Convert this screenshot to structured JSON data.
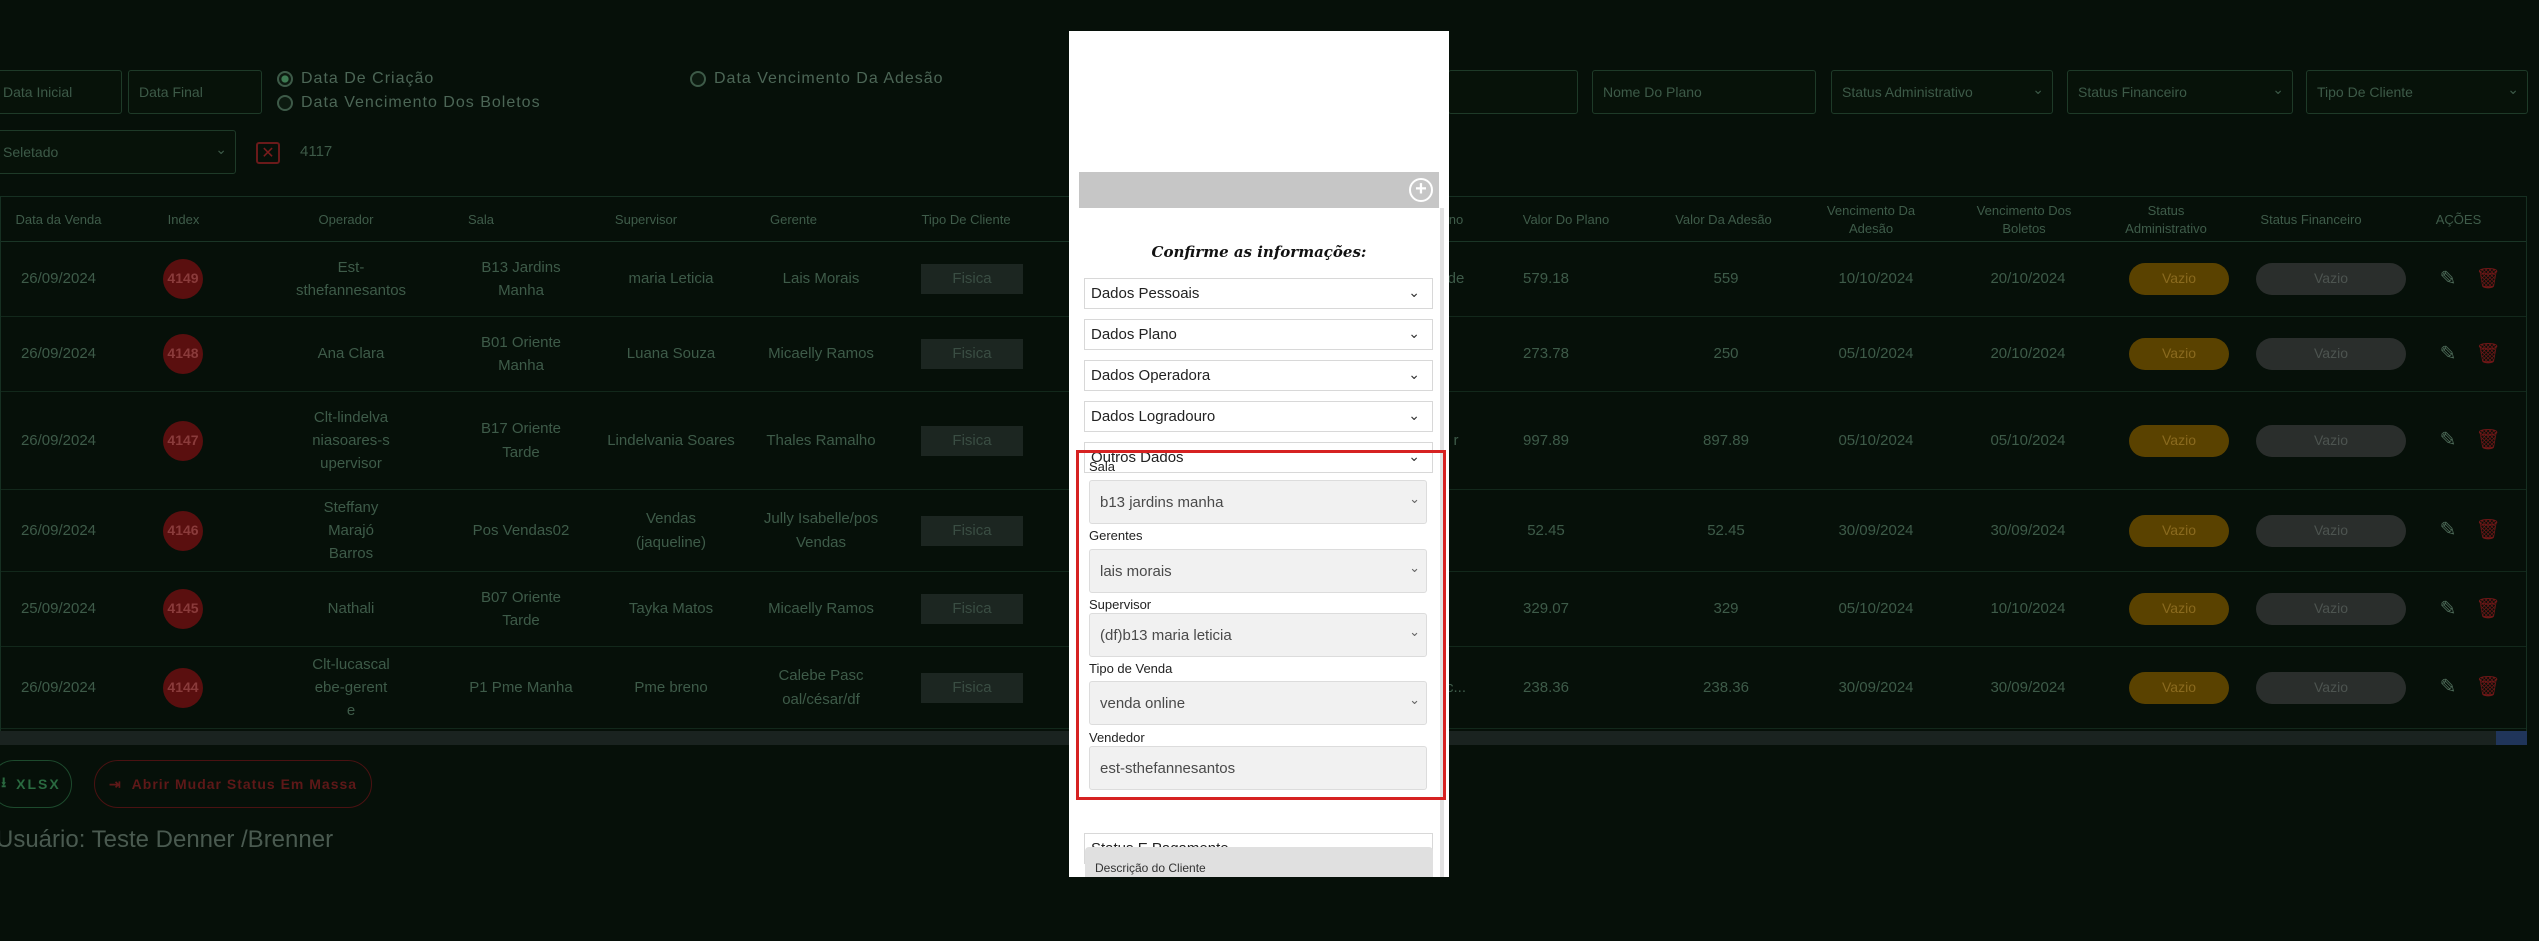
{
  "filters": {
    "data_inicial": "Data Inicial",
    "data_final": "Data Final",
    "radio_data_criacao": "Data De Criação",
    "radio_data_vencimento_boletos": "Data Vencimento Dos Boletos",
    "radio_data_vencimento_adesao": "Data Vencimento Da Adesão",
    "nome_do_plano": "Nome Do Plano",
    "status_administrativo": "Status Administrativo",
    "status_financeiro": "Status Financeiro",
    "tipo_de_cliente": "Tipo De Cliente",
    "selecionado": "Seletado",
    "clear_icon": "✕",
    "selected_count": "4117"
  },
  "table": {
    "headers": {
      "data_venda": "Data da Venda",
      "index": "Index",
      "operador": "Operador",
      "sala": "Sala",
      "supervisor": "Supervisor",
      "gerente": "Gerente",
      "tipo_cliente": "Tipo De Cliente",
      "plano": "no",
      "valor_plano": "Valor Do Plano",
      "valor_adesao": "Valor Da Adesão",
      "venc_adesao": "Vencimento Da Adesão",
      "venc_boletos": "Vencimento Dos Boletos",
      "status_adm": "Status Administrativo",
      "status_fin": "Status Financeiro",
      "acoes": "AÇÕES"
    },
    "rows": [
      {
        "data": "26/09/2024",
        "index": "4149",
        "operador": "Est-sthefannesantos",
        "sala": "B13 Jardins Manha",
        "supervisor": "maria Leticia",
        "gerente": "Lais Morais",
        "tipo": "Fisica",
        "plano": "de",
        "valor_plano": "579.18",
        "valor_adesao": "559",
        "venc_adesao": "10/10/2024",
        "venc_boletos": "20/10/2024",
        "status_adm": "Vazio",
        "status_fin": "Vazio"
      },
      {
        "data": "26/09/2024",
        "index": "4148",
        "operador": "Ana Clara",
        "sala": "B01 Oriente Manha",
        "supervisor": "Luana Souza",
        "gerente": "Micaelly Ramos",
        "tipo": "Fisica",
        "plano": "",
        "valor_plano": "273.78",
        "valor_adesao": "250",
        "venc_adesao": "05/10/2024",
        "venc_boletos": "20/10/2024",
        "status_adm": "Vazio",
        "status_fin": "Vazio"
      },
      {
        "data": "26/09/2024",
        "index": "4147",
        "operador": "Clt-lindelvaniasoares-supervisor",
        "sala": "B17 Oriente Tarde",
        "supervisor": "Lindelvania Soares",
        "gerente": "Thales Ramalho",
        "tipo": "Fisica",
        "plano": "r",
        "valor_plano": "997.89",
        "valor_adesao": "897.89",
        "venc_adesao": "05/10/2024",
        "venc_boletos": "05/10/2024",
        "status_adm": "Vazio",
        "status_fin": "Vazio"
      },
      {
        "data": "26/09/2024",
        "index": "4146",
        "operador": "Steffany Marajó Barros",
        "sala": "Pos Vendas02",
        "supervisor": "Vendas (jaqueline)",
        "gerente": "Jully Isabelle/pos Vendas",
        "tipo": "Fisica",
        "plano": "",
        "valor_plano": "52.45",
        "valor_adesao": "52.45",
        "venc_adesao": "30/09/2024",
        "venc_boletos": "30/09/2024",
        "status_adm": "Vazio",
        "status_fin": "Vazio"
      },
      {
        "data": "25/09/2024",
        "index": "4145",
        "operador": "Nathali",
        "sala": "B07 Oriente Tarde",
        "supervisor": "Tayka Matos",
        "gerente": "Micaelly Ramos",
        "tipo": "Fisica",
        "plano": "",
        "valor_plano": "329.07",
        "valor_adesao": "329",
        "venc_adesao": "05/10/2024",
        "venc_boletos": "10/10/2024",
        "status_adm": "Vazio",
        "status_fin": "Vazio"
      },
      {
        "data": "26/09/2024",
        "index": "4144",
        "operador": "Clt-lucascalebe-gerente",
        "sala": "P1 Pme Manha",
        "supervisor": "Pme breno",
        "gerente": "Calebe Pascoal/césar/df",
        "tipo": "Fisica",
        "plano": "c...",
        "valor_plano": "238.36",
        "valor_adesao": "238.36",
        "venc_adesao": "30/09/2024",
        "venc_boletos": "30/09/2024",
        "status_adm": "Vazio",
        "status_fin": "Vazio"
      }
    ]
  },
  "footer": {
    "xlsx_label": "XLSX",
    "mass_status_label": "Abrir Mudar Status Em Massa",
    "user_label": "Usuário: Teste Denner /Brenner"
  },
  "modal": {
    "title": "Confirme as informações:",
    "sections": [
      "Dados Pessoais",
      "Dados Plano",
      "Dados Operadora",
      "Dados Logradouro",
      "Outros Dados"
    ],
    "fields": {
      "sala_label": "Sala",
      "sala_value": "b13 jardins manha",
      "gerentes_label": "Gerentes",
      "gerentes_value": "lais morais",
      "supervisor_label": "Supervisor",
      "supervisor_value": "(df)b13 maria leticia",
      "tipo_venda_label": "Tipo de Venda",
      "tipo_venda_value": "venda online",
      "vendedor_label": "Vendedor",
      "vendedor_value": "est-sthefannesantos"
    },
    "status_pagamento": "Status E Pagamento",
    "descricao_cliente": "Descrição do Cliente"
  },
  "colors": {
    "highlight": "#d62222",
    "status_adm": "#5a4200",
    "index_badge": "#5a0f0f"
  }
}
